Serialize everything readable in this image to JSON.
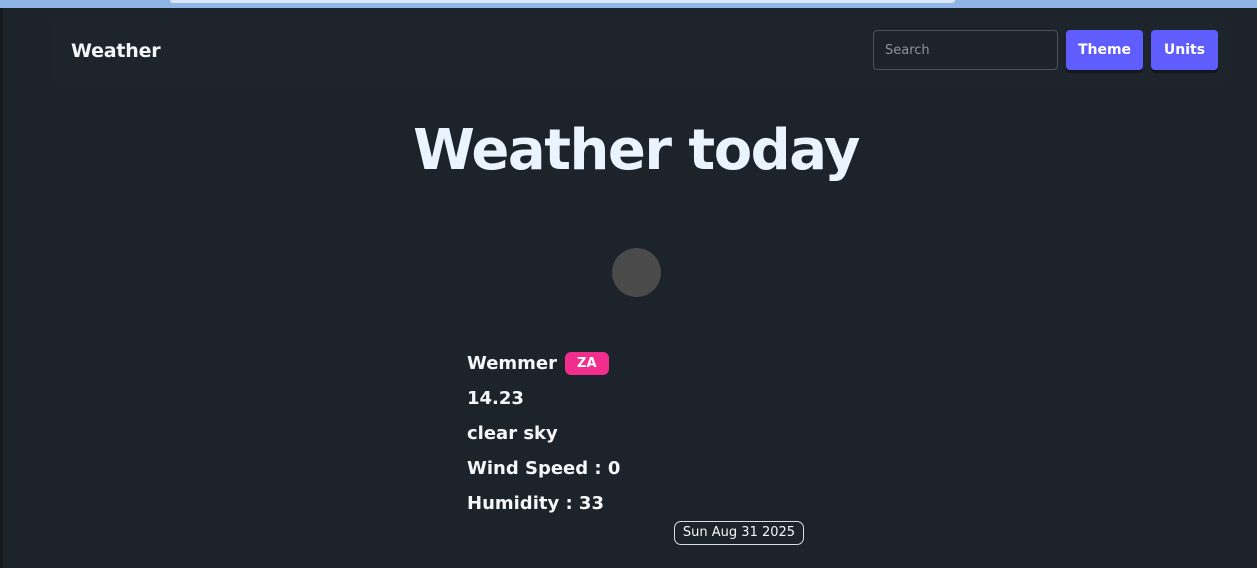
{
  "navbar": {
    "brand": "Weather",
    "search_placeholder": "Search",
    "search_value": "",
    "theme_label": "Theme",
    "units_label": "Units"
  },
  "main": {
    "title": "Weather today",
    "weather_icon": "weather-condition-icon",
    "city": "Wemmer",
    "country_code": "ZA",
    "temperature": "14.23",
    "description": "clear sky",
    "wind_speed": "Wind Speed : 0",
    "humidity": "Humidity : 33",
    "date": "Sun Aug 31 2025"
  },
  "colors": {
    "background": "#1d232a",
    "primary_button": "#605dff",
    "badge": "#f12e8c"
  }
}
